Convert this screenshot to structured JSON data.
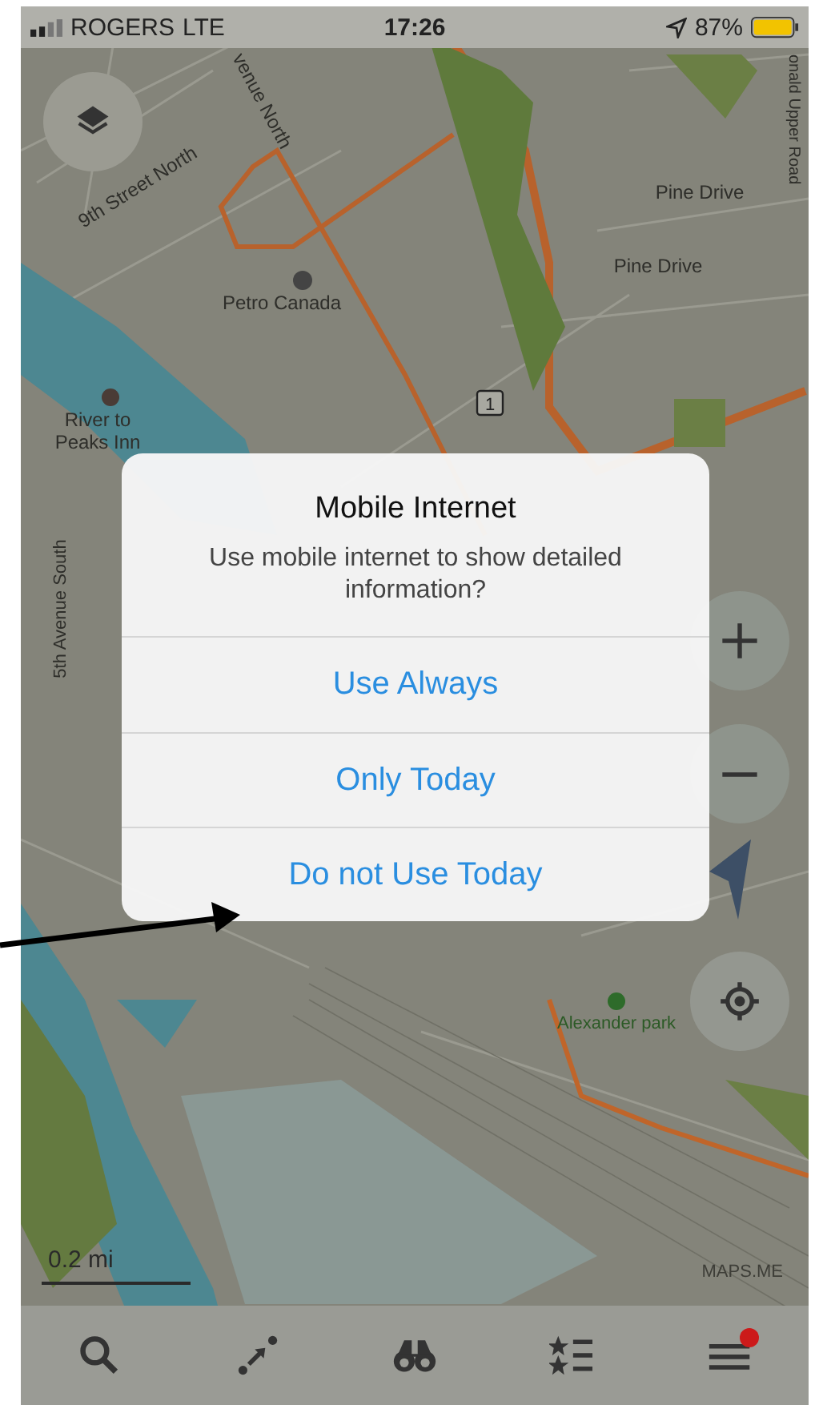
{
  "status_bar": {
    "carrier": "ROGERS",
    "network": "LTE",
    "time": "17:26",
    "battery": "87%"
  },
  "map": {
    "labels": [
      {
        "kind": "street",
        "text": "venue North"
      },
      {
        "kind": "street",
        "text": "9th Street North"
      },
      {
        "kind": "street",
        "text": "onald Upper Road"
      },
      {
        "kind": "street",
        "text": "Pine Drive"
      },
      {
        "kind": "street",
        "text": "Pine Drive"
      },
      {
        "kind": "fuel",
        "text": "Petro Canada"
      },
      {
        "kind": "hotel",
        "text": "River to Peaks Inn"
      },
      {
        "kind": "shield",
        "text": "1"
      },
      {
        "kind": "street",
        "text": "5th Avenue South"
      },
      {
        "kind": "park",
        "text": "Alexander park"
      }
    ],
    "scale": "0.2 mi",
    "attribution": "MAPS.ME"
  },
  "dialog": {
    "title": "Mobile Internet",
    "message": "Use mobile internet to show detailed information?",
    "buttons": [
      "Use Always",
      "Only Today",
      "Do not Use Today"
    ]
  },
  "tab_bar": {
    "items": [
      {
        "kind": "search",
        "badge": false
      },
      {
        "kind": "route",
        "badge": false
      },
      {
        "kind": "discover",
        "badge": false
      },
      {
        "kind": "bookmarks",
        "badge": false
      },
      {
        "kind": "menu",
        "badge": true
      }
    ]
  }
}
